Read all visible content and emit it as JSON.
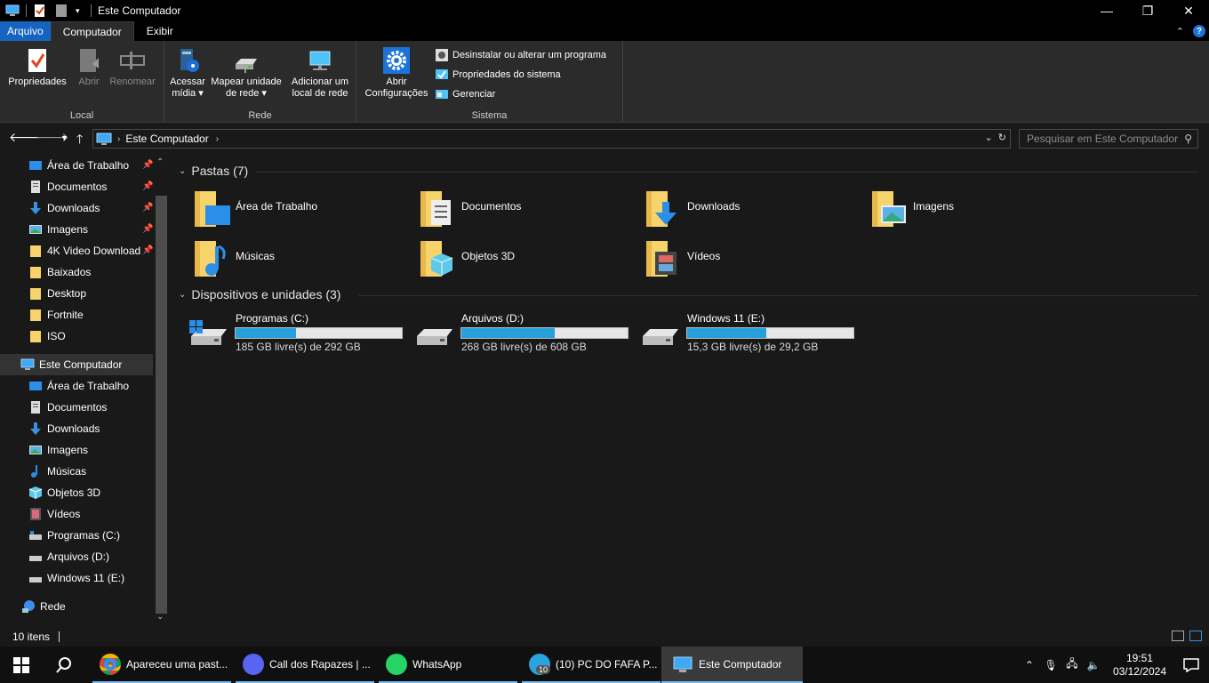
{
  "window": {
    "title": "Este Computador",
    "controls": {
      "minimize": "—",
      "maximize": "❐",
      "close": "✕"
    }
  },
  "tabs": {
    "file": "Arquivo",
    "computer": "Computador",
    "view": "Exibir",
    "help": "?"
  },
  "ribbon": {
    "local": {
      "label": "Local",
      "properties": "Propriedades",
      "open": "Abrir",
      "rename": "Renomear"
    },
    "network": {
      "label": "Rede",
      "media_line1": "Acessar",
      "media_line2": "mídia",
      "map_line1": "Mapear unidade",
      "map_line2": "de rede",
      "add_line1": "Adicionar um",
      "add_line2": "local de rede"
    },
    "system": {
      "label": "Sistema",
      "settings_line1": "Abrir",
      "settings_line2": "Configurações",
      "uninstall": "Desinstalar ou alterar um programa",
      "sys_props": "Propriedades do sistema",
      "manage": "Gerenciar"
    }
  },
  "address": {
    "crumb": "Este Computador",
    "search_placeholder": "Pesquisar em Este Computador"
  },
  "nav": {
    "quick": [
      {
        "label": "Área de Trabalho",
        "pinned": true
      },
      {
        "label": "Documentos",
        "pinned": true
      },
      {
        "label": "Downloads",
        "pinned": true
      },
      {
        "label": "Imagens",
        "pinned": true
      },
      {
        "label": "4K Video Download",
        "pinned": true
      },
      {
        "label": "Baixados",
        "pinned": false
      },
      {
        "label": "Desktop",
        "pinned": false
      },
      {
        "label": "Fortnite",
        "pinned": false
      },
      {
        "label": "ISO",
        "pinned": false
      }
    ],
    "this_pc": "Este Computador",
    "pc_items": [
      "Área de Trabalho",
      "Documentos",
      "Downloads",
      "Imagens",
      "Músicas",
      "Objetos 3D",
      "Vídeos",
      "Programas (C:)",
      "Arquivos (D:)",
      "Windows 11 (E:)"
    ],
    "network": "Rede"
  },
  "content": {
    "folders_header": "Pastas (7)",
    "folders": [
      "Área de Trabalho",
      "Documentos",
      "Downloads",
      "Imagens",
      "Músicas",
      "Objetos 3D",
      "Vídeos"
    ],
    "drives_header": "Dispositivos e unidades (3)",
    "drives": [
      {
        "name": "Programas (C:)",
        "space": "185 GB livre(s) de 292 GB",
        "used_fraction": 0.366
      },
      {
        "name": "Arquivos (D:)",
        "space": "268 GB livre(s) de 608 GB",
        "used_fraction": 0.559
      },
      {
        "name": "Windows 11 (E:)",
        "space": "15,3 GB livre(s) de 29,2 GB",
        "used_fraction": 0.476
      }
    ]
  },
  "status": {
    "count": "10 itens"
  },
  "taskbar": {
    "apps": [
      {
        "label": "Apareceu uma past...",
        "icon": "chrome-icon"
      },
      {
        "label": "Call dos Rapazes | ...",
        "icon": "discord-icon"
      },
      {
        "label": "WhatsApp",
        "icon": "whatsapp-icon"
      },
      {
        "label": "(10) PC DO FAFA P...",
        "icon": "telegram-icon",
        "badge": "10"
      },
      {
        "label": "Este Computador",
        "icon": "explorer-icon"
      }
    ],
    "time": "19:51",
    "date": "03/12/2024"
  }
}
